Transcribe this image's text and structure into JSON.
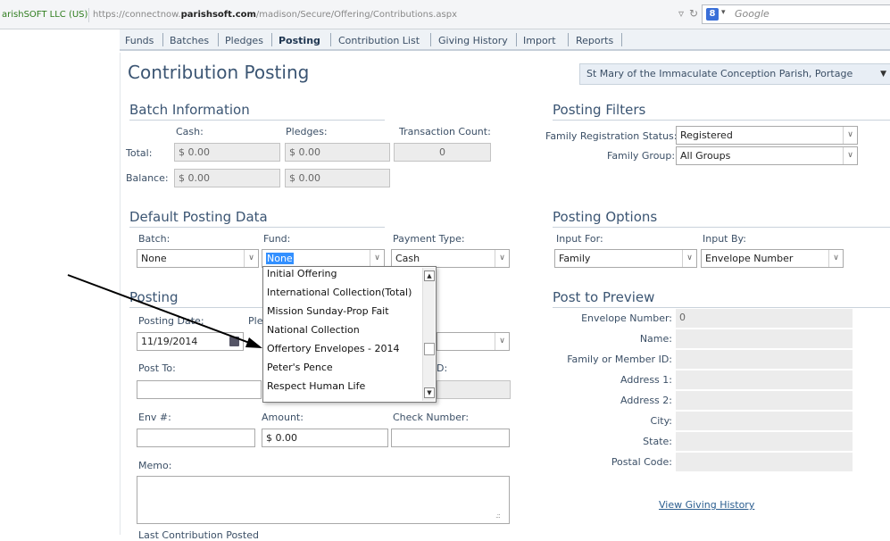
{
  "browser": {
    "site_identity": "arishSOFT LLC (US)",
    "url_prefix": "https://connectnow.",
    "url_domain": "parishsoft.com",
    "url_path": "/madison/Secure/Offering/Contributions.aspx",
    "search_placeholder": "Google"
  },
  "nav": {
    "tabs": [
      "Funds",
      "Batches",
      "Pledges",
      "Posting",
      "Contribution List",
      "Giving History",
      "Import",
      "Reports"
    ],
    "active": "Posting"
  },
  "page": {
    "title": "Contribution Posting",
    "parish": "St Mary of the Immaculate Conception Parish, Portage"
  },
  "batch_info": {
    "title": "Batch Information",
    "col_cash": "Cash:",
    "col_pledges": "Pledges:",
    "col_count": "Transaction Count:",
    "row_total": "Total:",
    "row_balance": "Balance:",
    "total_cash": "$ 0.00",
    "total_pledges": "$ 0.00",
    "total_count": "0",
    "balance_cash": "$ 0.00",
    "balance_pledges": "$ 0.00"
  },
  "filters": {
    "title": "Posting Filters",
    "reg_status_label": "Family Registration Status:",
    "reg_status_value": "Registered",
    "family_group_label": "Family Group:",
    "family_group_value": "All Groups"
  },
  "default_posting": {
    "title": "Default Posting Data",
    "batch_label": "Batch:",
    "batch_value": "None",
    "fund_label": "Fund:",
    "fund_value": "None",
    "payment_label": "Payment Type:",
    "payment_value": "Cash"
  },
  "options": {
    "title": "Posting Options",
    "input_for_label": "Input For:",
    "input_for_value": "Family",
    "input_by_label": "Input By:",
    "input_by_value": "Envelope Number"
  },
  "fund_dropdown": {
    "options": [
      "Initial Offering",
      "International Collection(Total)",
      "Mission Sunday-Prop Fait",
      "National Collection",
      "Offertory Envelopes - 2014",
      "Peter's Pence",
      "Respect Human Life"
    ]
  },
  "posting": {
    "title": "Posting",
    "date_label": "Posting Date:",
    "date_value": "11/19/2014",
    "pledge_label": "Ple",
    "post_to_label": "Post To:",
    "member_id_label": "D:",
    "env_label": "Env #:",
    "amount_label": "Amount:",
    "amount_value": "$ 0.00",
    "check_label": "Check Number:",
    "memo_label": "Memo:",
    "last_posted_label": "Last Contribution Posted"
  },
  "preview": {
    "title": "Post to Preview",
    "fields": [
      {
        "label": "Envelope Number:",
        "value": "0"
      },
      {
        "label": "Name:",
        "value": ""
      },
      {
        "label": "Family or Member ID:",
        "value": ""
      },
      {
        "label": "Address 1:",
        "value": ""
      },
      {
        "label": "Address 2:",
        "value": ""
      },
      {
        "label": "City:",
        "value": ""
      },
      {
        "label": "State:",
        "value": ""
      },
      {
        "label": "Postal Code:",
        "value": ""
      }
    ],
    "giving_history_link": "View Giving History"
  }
}
